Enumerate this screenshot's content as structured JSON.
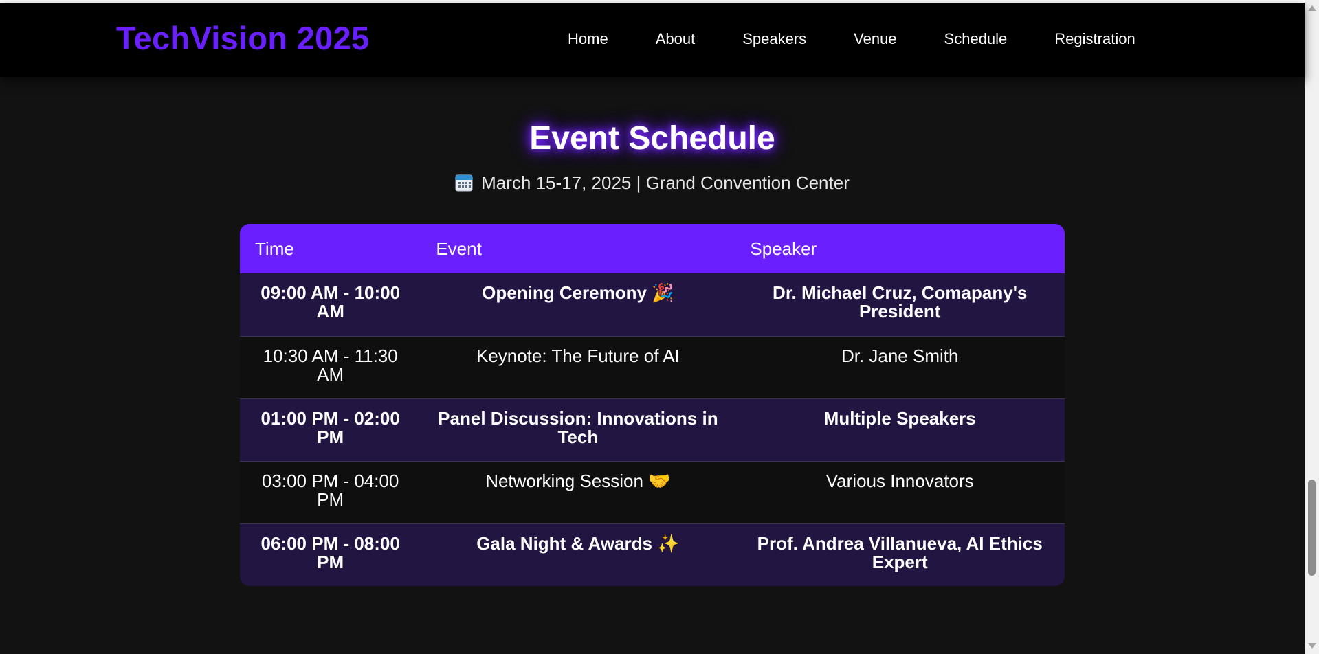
{
  "header": {
    "logo": "TechVision 2025",
    "nav": [
      {
        "label": "Home"
      },
      {
        "label": "About"
      },
      {
        "label": "Speakers"
      },
      {
        "label": "Venue"
      },
      {
        "label": "Schedule"
      },
      {
        "label": "Registration"
      }
    ]
  },
  "main": {
    "title": "Event Schedule",
    "subtitle_icon": "calendar-icon",
    "subtitle": "March 15-17, 2025 | Grand Convention Center"
  },
  "table": {
    "headers": {
      "time": "Time",
      "event": "Event",
      "speaker": "Speaker"
    },
    "rows": [
      {
        "time": "09:00 AM - 10:00 AM",
        "event": "Opening Ceremony 🎉",
        "speaker": "Dr. Michael Cruz, Comapany's President"
      },
      {
        "time": "10:30 AM - 11:30 AM",
        "event": "Keynote: The Future of AI",
        "speaker": "Dr. Jane Smith"
      },
      {
        "time": "01:00 PM - 02:00 PM",
        "event": "Panel Discussion: Innovations in Tech",
        "speaker": "Multiple Speakers"
      },
      {
        "time": "03:00 PM - 04:00 PM",
        "event": "Networking Session 🤝",
        "speaker": "Various Innovators"
      },
      {
        "time": "06:00 PM - 08:00 PM",
        "event": "Gala Night & Awards ✨",
        "speaker": "Prof. Andrea Villanueva, AI Ethics Expert"
      }
    ]
  },
  "colors": {
    "accent": "#6a1fff",
    "page_bg": "#121212",
    "nav_bg": "#000000",
    "row_alt_bg": "#231542"
  }
}
